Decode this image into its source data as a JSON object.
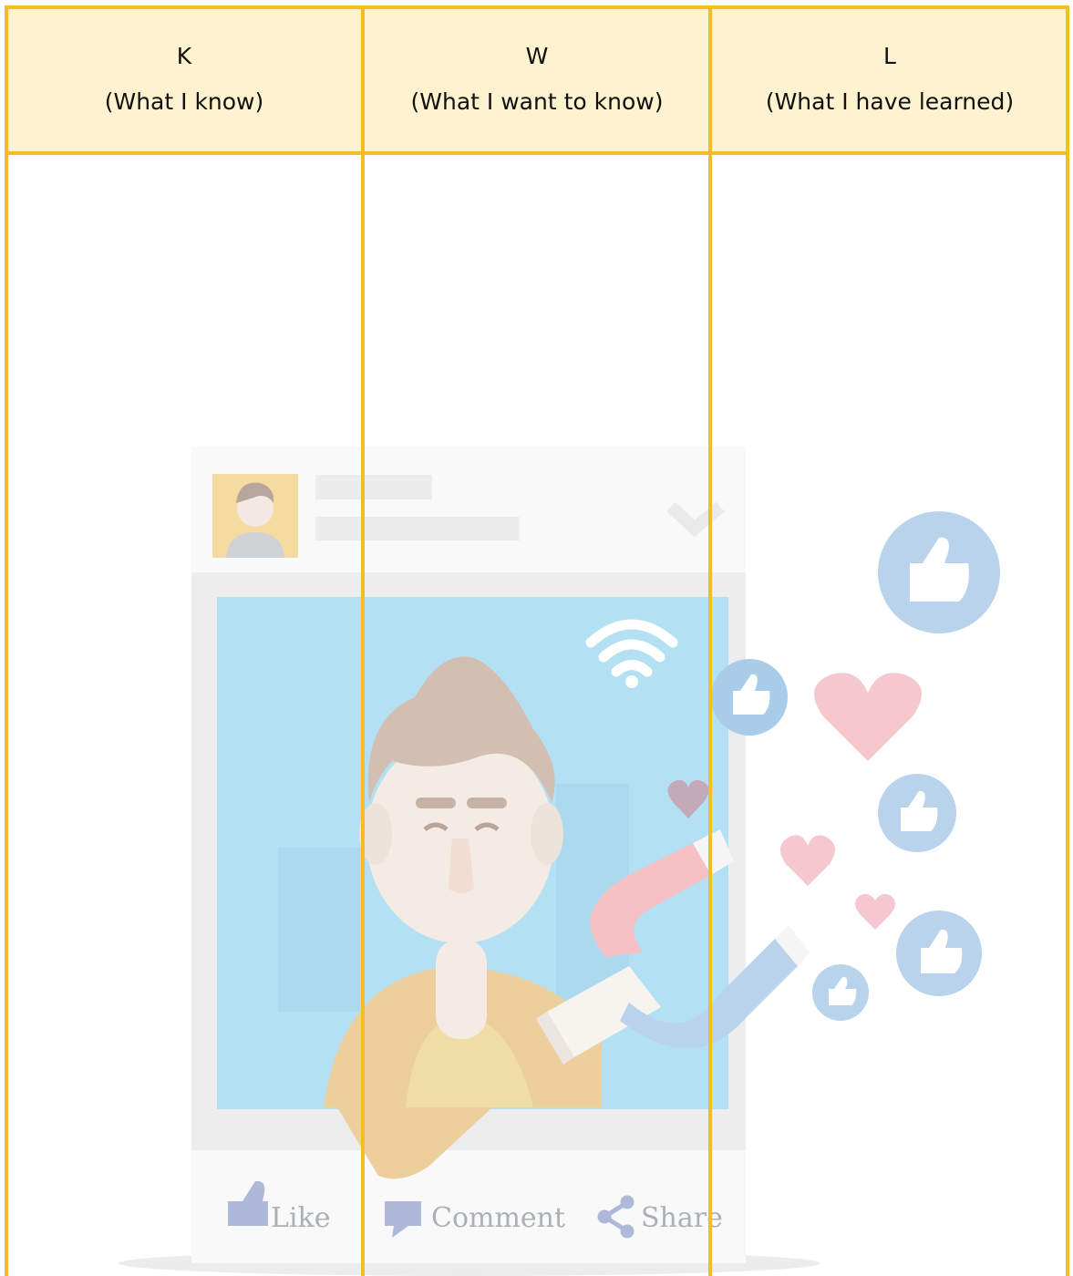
{
  "columns": [
    {
      "letter": "K",
      "caption": "(What I know)"
    },
    {
      "letter": "W",
      "caption": "(What I want to know)"
    },
    {
      "letter": "L",
      "caption": "(What I have learned)"
    }
  ],
  "post_actions": {
    "like": "Like",
    "comment": "Comment",
    "share": "Share"
  },
  "colors": {
    "border": "#f7bc25",
    "header_fill": "#fff2cf"
  }
}
